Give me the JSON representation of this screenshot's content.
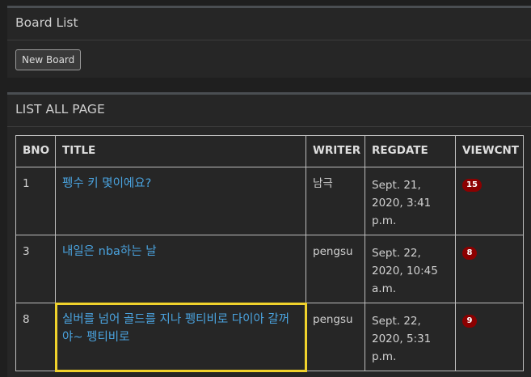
{
  "board_panel": {
    "title": "Board List",
    "new_board_label": "New Board"
  },
  "list_panel": {
    "title": "LIST ALL PAGE",
    "columns": [
      "BNO",
      "TITLE",
      "WRITER",
      "REGDATE",
      "VIEWCNT"
    ],
    "rows": [
      {
        "bno": "1",
        "title": "펭수 키 몇이에요?",
        "writer": "남극",
        "regdate": "Sept. 21, 2020, 3:41 p.m.",
        "viewcnt": "15"
      },
      {
        "bno": "3",
        "title": "내일은 nba하는 날",
        "writer": "pengsu",
        "regdate": "Sept. 22, 2020, 10:45 a.m.",
        "viewcnt": "8"
      },
      {
        "bno": "8",
        "title": "실버를 넘어 골드를 지나 펭티비로 다이아 갈꺼야~ 펭티비로",
        "writer": "pengsu",
        "regdate": "Sept. 22, 2020, 5:31 p.m.",
        "viewcnt": "9"
      }
    ]
  },
  "colors": {
    "link": "#4aa3df",
    "badge": "#8b0000",
    "highlight": "#f0d22c"
  }
}
